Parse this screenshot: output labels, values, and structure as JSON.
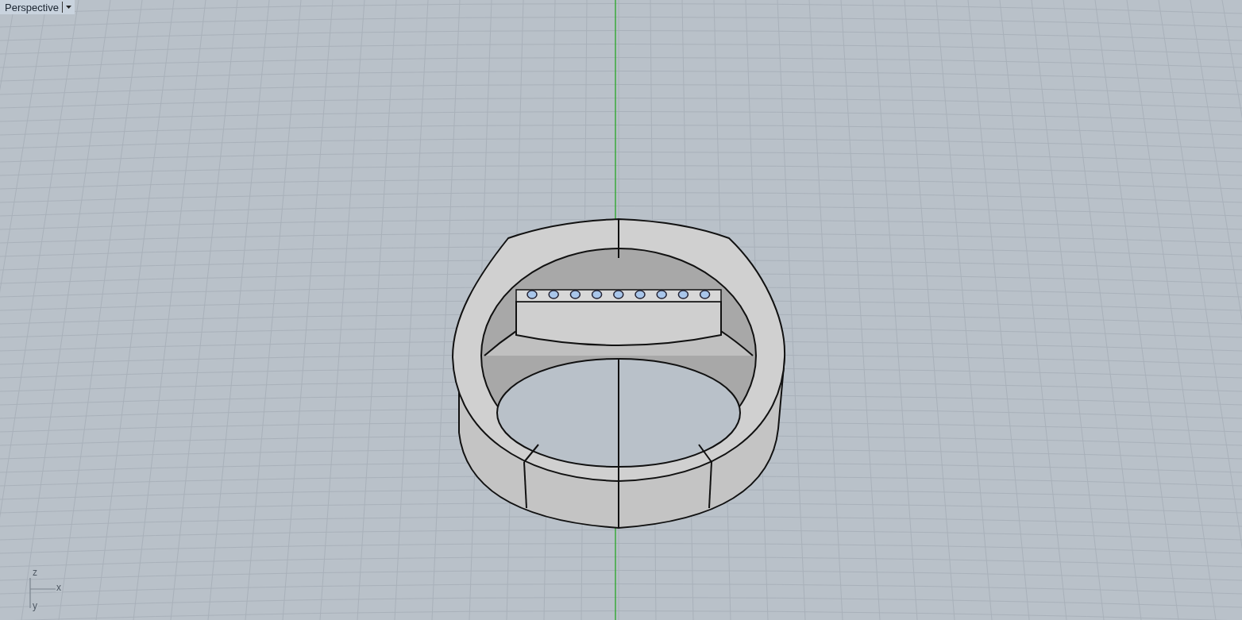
{
  "viewport": {
    "tab": {
      "label": "Perspective"
    }
  },
  "axis_labels": [
    {
      "kind": "z",
      "text": "z"
    },
    {
      "kind": "x",
      "text": "x"
    },
    {
      "kind": "y",
      "text": "y"
    }
  ]
}
